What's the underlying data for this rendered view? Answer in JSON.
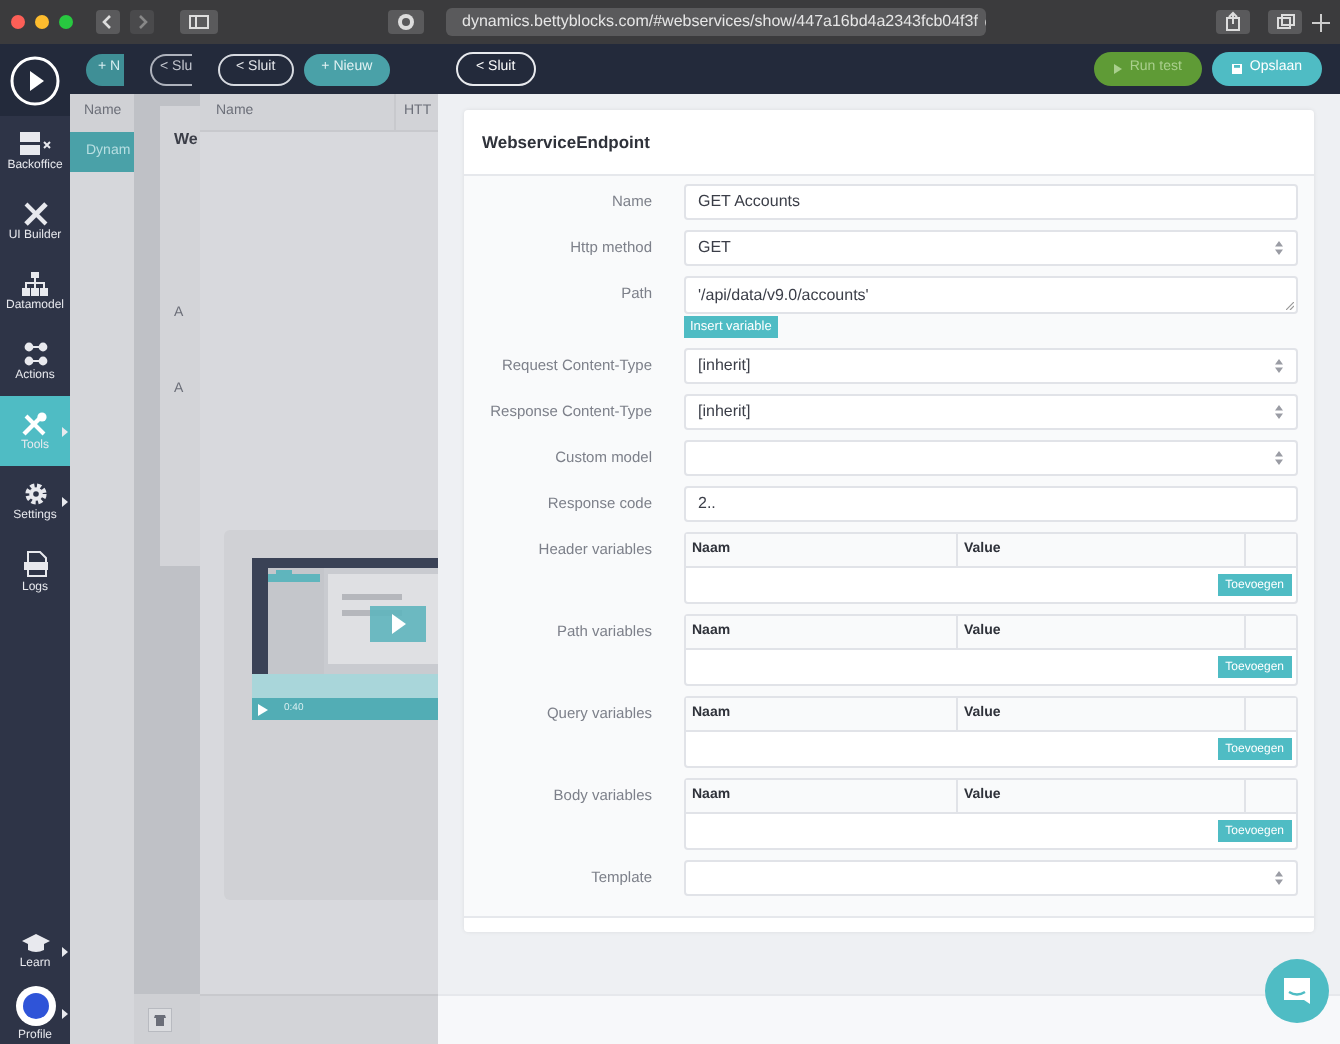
{
  "browser": {
    "url": "dynamics.bettyblocks.com/#webservices/show/447a16bd4a2343fcb04f3f"
  },
  "sidebar": {
    "items": [
      {
        "label": "Backoffice",
        "selected": false,
        "submenu": false
      },
      {
        "label": "UI Builder",
        "selected": false,
        "submenu": false
      },
      {
        "label": "Datamodel",
        "selected": false,
        "submenu": false
      },
      {
        "label": "Actions",
        "selected": false,
        "submenu": false
      },
      {
        "label": "Tools",
        "selected": true,
        "submenu": true
      },
      {
        "label": "Settings",
        "selected": false,
        "submenu": true
      },
      {
        "label": "Logs",
        "selected": false,
        "submenu": false
      }
    ],
    "bottom_items": [
      {
        "label": "Learn",
        "submenu": true
      },
      {
        "label": "Profile",
        "submenu": true
      }
    ]
  },
  "list_panel": {
    "new_button": "+ N",
    "column": "Name",
    "row": "Dynam"
  },
  "detail_panel": {
    "close_button": "< Slu",
    "title": "We",
    "labels": [
      "A",
      "A"
    ]
  },
  "webservice_panel": {
    "close_button": "< Sluit",
    "new_button": "+ Nieuw",
    "columns": [
      "Name",
      "HTT"
    ],
    "video": {
      "time": "0:40"
    }
  },
  "endpoint_panel": {
    "close_button": "< Sluit",
    "run_button": "Run test",
    "save_button": "Opslaan",
    "title": "WebserviceEndpoint",
    "fields": [
      {
        "kind": "text",
        "label": "Name",
        "value": "GET Accounts"
      },
      {
        "kind": "select",
        "label": "Http method",
        "value": "GET"
      },
      {
        "kind": "textarea",
        "label": "Path",
        "value": "'/api/data/v9.0/accounts'",
        "button": "Insert variable"
      },
      {
        "kind": "select",
        "label": "Request Content-Type",
        "value": "[inherit]"
      },
      {
        "kind": "select",
        "label": "Response Content-Type",
        "value": "[inherit]"
      },
      {
        "kind": "select",
        "label": "Custom model"
      },
      {
        "kind": "text",
        "label": "Response code",
        "value": "2.."
      },
      {
        "kind": "table",
        "label": "Header variables",
        "columns": [
          "Naam",
          "Value"
        ],
        "button": "Toevoegen"
      },
      {
        "kind": "table",
        "label": "Path variables",
        "columns": [
          "Naam",
          "Value"
        ],
        "button": "Toevoegen"
      },
      {
        "kind": "table",
        "label": "Query variables",
        "columns": [
          "Naam",
          "Value"
        ],
        "button": "Toevoegen"
      },
      {
        "kind": "table",
        "label": "Body variables",
        "columns": [
          "Naam",
          "Value"
        ],
        "button": "Toevoegen"
      },
      {
        "kind": "select",
        "label": "Template"
      }
    ]
  }
}
